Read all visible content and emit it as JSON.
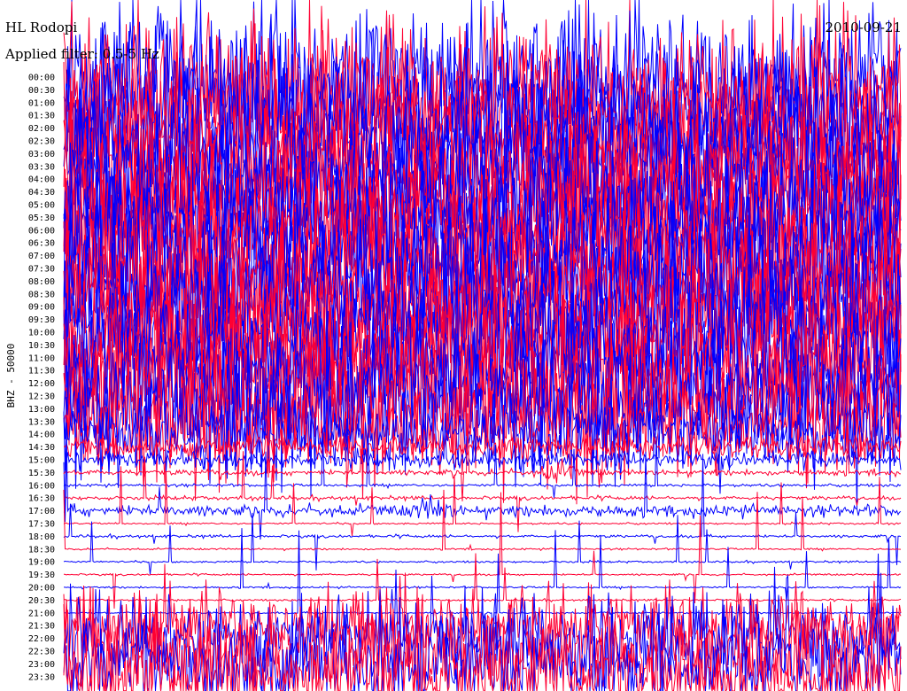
{
  "chart_data": {
    "type": "line",
    "title": "HL Rodopi",
    "date": "2010-09-21",
    "subtitle": "Applied filter: 0.5-5 Hz",
    "ylabel": "BHZ - 50000",
    "colors": {
      "line_a": "#0000ff",
      "line_b": "#ff0033",
      "background": "#ffffff"
    },
    "grid": false,
    "x": [
      "00:00",
      "00:30",
      "01:00",
      "01:30",
      "02:00",
      "02:30",
      "03:00",
      "03:30",
      "04:00",
      "04:30",
      "05:00",
      "05:30",
      "06:00",
      "06:30",
      "07:00",
      "07:30",
      "08:00",
      "08:30",
      "09:00",
      "09:30",
      "10:00",
      "10:30",
      "11:00",
      "11:30",
      "12:00",
      "12:30",
      "13:00",
      "13:30",
      "14:00",
      "14:30",
      "15:00",
      "15:30",
      "16:00",
      "16:30",
      "17:00",
      "17:30",
      "18:00",
      "18:30",
      "19:00",
      "19:30",
      "20:00",
      "20:30",
      "21:00",
      "21:30",
      "22:00",
      "22:30",
      "23:00",
      "23:30"
    ],
    "series": [
      {
        "values": [
          8,
          8,
          8,
          8,
          8,
          8,
          8,
          8,
          8,
          8,
          8,
          8,
          8,
          8,
          8,
          8,
          8,
          8,
          8,
          8,
          8,
          8,
          8,
          8,
          8,
          8,
          7,
          6,
          4,
          1.2,
          0.8,
          0.3,
          0.15,
          0.2,
          0.6,
          0.1,
          0.15,
          0.1,
          0.1,
          0.1,
          0.1,
          0.1,
          0.1,
          4,
          5,
          6,
          6,
          6
        ]
      }
    ]
  }
}
